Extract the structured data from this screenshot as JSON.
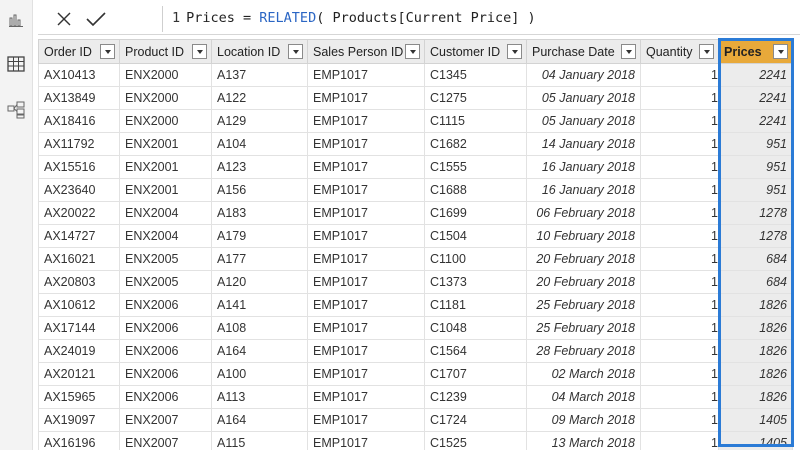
{
  "formula": {
    "line": "1",
    "lhs": "Prices = ",
    "func": "RELATED",
    "args": "( Products[Current Price] )"
  },
  "columns": [
    "Order ID",
    "Product ID",
    "Location ID",
    "Sales Person ID",
    "Customer ID",
    "Purchase Date",
    "Quantity",
    "Prices"
  ],
  "rows": [
    {
      "order": "AX10413",
      "product": "ENX2000",
      "location": "A137",
      "person": "EMP1017",
      "customer": "C1345",
      "date": "04 January 2018",
      "qty": "1",
      "price": "2241"
    },
    {
      "order": "AX13849",
      "product": "ENX2000",
      "location": "A122",
      "person": "EMP1017",
      "customer": "C1275",
      "date": "05 January 2018",
      "qty": "1",
      "price": "2241"
    },
    {
      "order": "AX18416",
      "product": "ENX2000",
      "location": "A129",
      "person": "EMP1017",
      "customer": "C1115",
      "date": "05 January 2018",
      "qty": "1",
      "price": "2241"
    },
    {
      "order": "AX11792",
      "product": "ENX2001",
      "location": "A104",
      "person": "EMP1017",
      "customer": "C1682",
      "date": "14 January 2018",
      "qty": "1",
      "price": "951"
    },
    {
      "order": "AX15516",
      "product": "ENX2001",
      "location": "A123",
      "person": "EMP1017",
      "customer": "C1555",
      "date": "16 January 2018",
      "qty": "1",
      "price": "951"
    },
    {
      "order": "AX23640",
      "product": "ENX2001",
      "location": "A156",
      "person": "EMP1017",
      "customer": "C1688",
      "date": "16 January 2018",
      "qty": "1",
      "price": "951"
    },
    {
      "order": "AX20022",
      "product": "ENX2004",
      "location": "A183",
      "person": "EMP1017",
      "customer": "C1699",
      "date": "06 February 2018",
      "qty": "1",
      "price": "1278"
    },
    {
      "order": "AX14727",
      "product": "ENX2004",
      "location": "A179",
      "person": "EMP1017",
      "customer": "C1504",
      "date": "10 February 2018",
      "qty": "1",
      "price": "1278"
    },
    {
      "order": "AX16021",
      "product": "ENX2005",
      "location": "A177",
      "person": "EMP1017",
      "customer": "C1100",
      "date": "20 February 2018",
      "qty": "1",
      "price": "684"
    },
    {
      "order": "AX20803",
      "product": "ENX2005",
      "location": "A120",
      "person": "EMP1017",
      "customer": "C1373",
      "date": "20 February 2018",
      "qty": "1",
      "price": "684"
    },
    {
      "order": "AX10612",
      "product": "ENX2006",
      "location": "A141",
      "person": "EMP1017",
      "customer": "C1181",
      "date": "25 February 2018",
      "qty": "1",
      "price": "1826"
    },
    {
      "order": "AX17144",
      "product": "ENX2006",
      "location": "A108",
      "person": "EMP1017",
      "customer": "C1048",
      "date": "25 February 2018",
      "qty": "1",
      "price": "1826"
    },
    {
      "order": "AX24019",
      "product": "ENX2006",
      "location": "A164",
      "person": "EMP1017",
      "customer": "C1564",
      "date": "28 February 2018",
      "qty": "1",
      "price": "1826"
    },
    {
      "order": "AX20121",
      "product": "ENX2006",
      "location": "A100",
      "person": "EMP1017",
      "customer": "C1707",
      "date": "02 March 2018",
      "qty": "1",
      "price": "1826"
    },
    {
      "order": "AX15965",
      "product": "ENX2006",
      "location": "A113",
      "person": "EMP1017",
      "customer": "C1239",
      "date": "04 March 2018",
      "qty": "1",
      "price": "1826"
    },
    {
      "order": "AX19097",
      "product": "ENX2007",
      "location": "A164",
      "person": "EMP1017",
      "customer": "C1724",
      "date": "09 March 2018",
      "qty": "1",
      "price": "1405"
    },
    {
      "order": "AX16196",
      "product": "ENX2007",
      "location": "A115",
      "person": "EMP1017",
      "customer": "C1525",
      "date": "13 March 2018",
      "qty": "1",
      "price": "1405"
    }
  ],
  "icons": {
    "report": "bar-chart-icon",
    "data": "table-grid-icon",
    "model": "model-diagram-icon",
    "cancel": "close-icon",
    "commit": "checkmark-icon"
  },
  "colors": {
    "highlight": "#e8a93a",
    "selection": "#2b7bd6",
    "keyword": "#2b66c4"
  }
}
